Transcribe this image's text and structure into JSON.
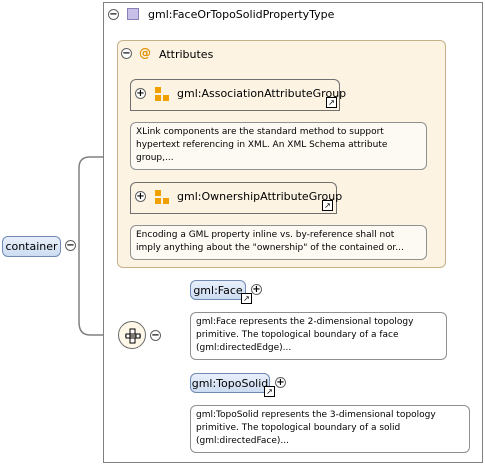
{
  "type_box": {
    "title": "gml:FaceOrTopoSolidPropertyType"
  },
  "attributes": {
    "header_icon": "at-sign-icon",
    "title": "Attributes",
    "groups": [
      {
        "name": "gml:AssociationAttributeGroup",
        "doc_lines": [
          "XLink components are the standard method to support",
          "hypertext referencing in XML. An XML Schema attribute",
          "group,..."
        ]
      },
      {
        "name": "gml:OwnershipAttributeGroup",
        "doc_lines": [
          "Encoding a GML property inline vs. by-reference shall not",
          "imply anything about the \"ownership\" of the contained or..."
        ]
      }
    ]
  },
  "root": {
    "label": "container"
  },
  "choice": {
    "elements": [
      {
        "name": "gml:Face",
        "doc_lines": [
          "gml:Face represents the 2-dimensional topology",
          "primitive. The topological boundary of a face",
          "(gml:directedEdge)..."
        ]
      },
      {
        "name": "gml:TopoSolid",
        "doc_lines": [
          "gml:TopoSolid represents the 3-dimensional topology",
          "primitive. The topological boundary of a solid",
          "(gml:directedFace)..."
        ]
      }
    ]
  },
  "icons": {
    "collapse": "minus-toggle-icon",
    "expand": "plus-toggle-icon",
    "link": "link-arrow-icon",
    "type": "complex-type-icon",
    "attribute_group": "attribute-group-icon",
    "sequence": "sequence-compositor-icon"
  },
  "colors": {
    "type_icon": "#c8c0e8",
    "attribute_panel": "#fcf3e3",
    "element_fill": "#dbe6f7",
    "attr_group_icon": "#f0a000",
    "connector": "#808080"
  }
}
